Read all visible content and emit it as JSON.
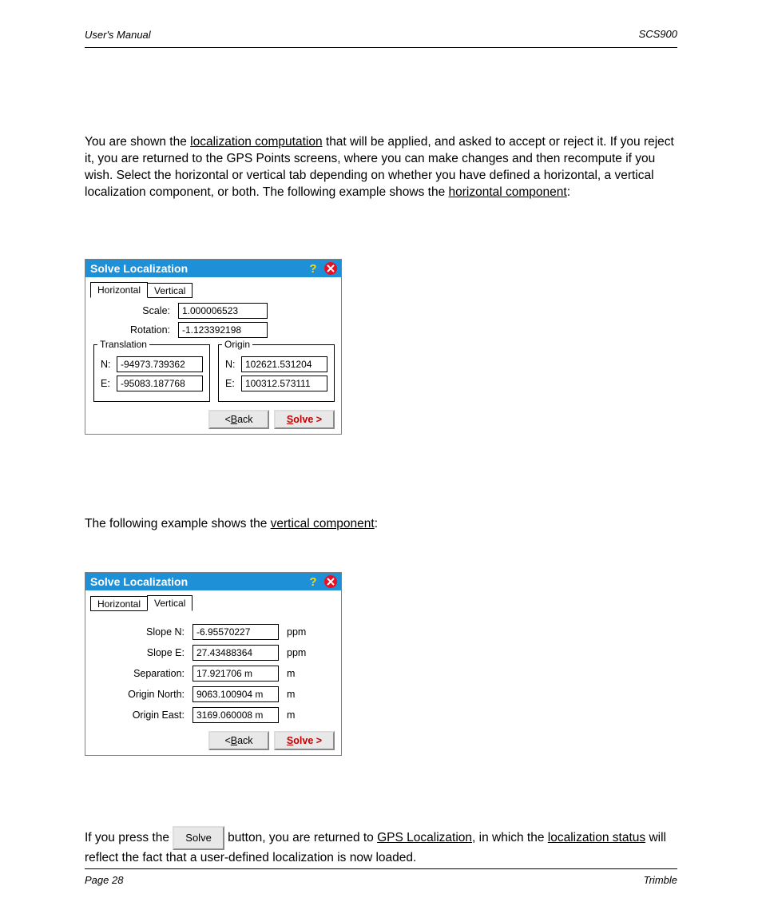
{
  "header": {
    "left": "User's Manual",
    "right": "SCS900"
  },
  "para1": {
    "pre": "You are shown the ",
    "link": "localization computation",
    "post": " that will be applied, and asked to accept or reject it. If you reject it, you are returned to the GPS Points screens, where you can make changes and then recompute if you wish. Select the horizontal or vertical tab depending on whether you have defined a horizontal, a vertical localization component, or both. The following example shows the ",
    "link2": "horizontal component",
    "post2": ":"
  },
  "dialog1": {
    "title": "Solve Localization",
    "tabs": {
      "horizontal": "Horizontal",
      "vertical": "Vertical"
    },
    "scale_label": "Scale:",
    "scale": "1.000006523",
    "rotation_label": "Rotation:",
    "rotation": "-1.123392198",
    "translation_legend": "Translation",
    "origin_legend": "Origin",
    "tN_label": "N:",
    "tN": "-94973.739362",
    "tE_label": "E:",
    "tE": "-95083.187768",
    "oN_label": "N:",
    "oN": "102621.531204",
    "oE_label": "E:",
    "oE": "100312.573111",
    "back": "< Back",
    "solve": "Solve >"
  },
  "para2": {
    "pre": "The following example shows the ",
    "link": "vertical component",
    "post": ":"
  },
  "dialog2": {
    "title": "Solve Localization",
    "tabs": {
      "horizontal": "Horizontal",
      "vertical": "Vertical"
    },
    "slopeN_label": "Slope N:",
    "slopeN": "-6.95570227",
    "slopeN_unit": "ppm",
    "slopeE_label": "Slope E:",
    "slopeE": "27.43488364",
    "slopeE_unit": "ppm",
    "sep_label": "Separation:",
    "sep": "17.921706 m",
    "sep_unit": "m",
    "origN_label": "Origin North:",
    "origN": "9063.100904 m",
    "origN_unit": "m",
    "origE_label": "Origin East:",
    "origE": "3169.060008 m",
    "origE_unit": "m",
    "back": "< Back",
    "solve": "Solve >"
  },
  "para3": {
    "pre": "If you press the ",
    "btn": "Solve",
    "mid": " button, you are returned to ",
    "link1": "GPS Localization",
    "mid2": ", in which the ",
    "link2": "localization status",
    "post": " will reflect the fact that a user-defined localization is now loaded."
  },
  "footer": {
    "left": "Page 28",
    "right": "Trimble"
  }
}
